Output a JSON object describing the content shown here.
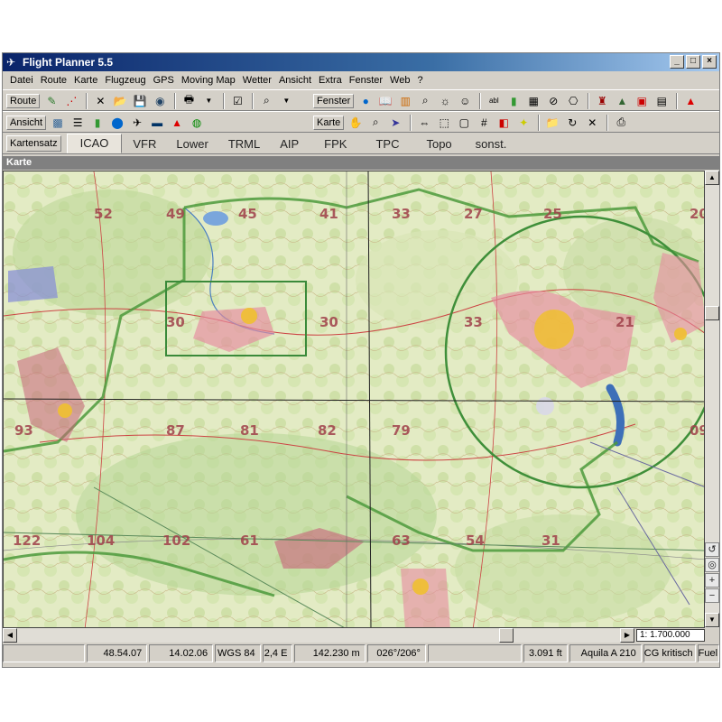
{
  "window": {
    "title": "Flight Planner 5.5"
  },
  "menu": [
    "Datei",
    "Route",
    "Karte",
    "Flugzeug",
    "GPS",
    "Moving Map",
    "Wetter",
    "Ansicht",
    "Extra",
    "Fenster",
    "Web",
    "?"
  ],
  "toolbar": {
    "route_label": "Route",
    "fenster_label": "Fenster",
    "ansicht_label": "Ansicht",
    "karte_label": "Karte"
  },
  "chart_tabs": {
    "label": "Kartensatz",
    "tabs": [
      "ICAO",
      "VFR",
      "Lower",
      "TRML",
      "AIP",
      "FPK",
      "TPC",
      "Topo",
      "sonst."
    ],
    "active": "ICAO"
  },
  "panel": {
    "title": "Karte"
  },
  "map": {
    "scale": "1: 1.700.000",
    "grid_labels": [
      "52",
      "49",
      "45",
      "41",
      "33",
      "27",
      "25",
      "20",
      "30",
      "30",
      "33",
      "21",
      "93",
      "87",
      "81",
      "82",
      "79",
      "09",
      "122",
      "104",
      "102",
      "63",
      "54",
      "31",
      "61"
    ]
  },
  "status": {
    "coord": "48.54.07",
    "date": "14.02.06",
    "datum": "WGS 84",
    "variation": "2,4 E",
    "distance": "142.230 m",
    "course": "026°/206°",
    "altitude": "3.091 ft",
    "aircraft": "Aquila A 210",
    "cg": "CG kritisch",
    "fuel": "Fuel"
  }
}
